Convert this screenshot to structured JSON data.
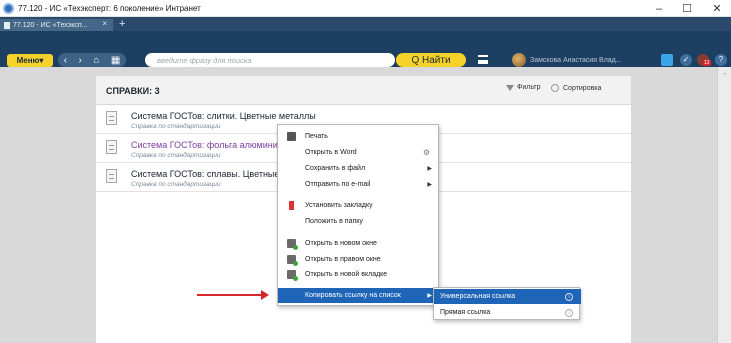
{
  "window": {
    "title": "77.120 - ИС «Техэксперт: 6 поколение» Интранет",
    "minimize": "–",
    "maximize": "☐",
    "close": "✕"
  },
  "tabs": {
    "active_label": "77.120 - ИС «Техэксп...",
    "close": "×",
    "add": "+"
  },
  "toolbar": {
    "menu_label": "Меню▾",
    "search_placeholder": "введите фразу для поиска",
    "find_label": "Q Найти",
    "user_name": "Замскова Анастасия Влад...",
    "notification_count": "12",
    "help": "?"
  },
  "panel": {
    "title": "СПРАВКИ: 3",
    "filter_label": "Фильтр",
    "sort_label": "Сортировка",
    "documents": [
      {
        "title": "Система ГОСТов: слитки. Цветные металлы",
        "subtitle": "Справка по стандартизации"
      },
      {
        "title": "Система ГОСТов: фольга алюминие",
        "subtitle": "Справка по стандартизации"
      },
      {
        "title": "Система ГОСТов: сплавы. Цветные",
        "subtitle": "Справка по стандартизации"
      }
    ]
  },
  "context_menu": {
    "items": [
      {
        "label": "Печать",
        "icon": "printer-icon"
      },
      {
        "label": "Открыть в Word",
        "icon": "gear-icon"
      },
      {
        "label": "Сохранить в файл",
        "icon": "submenu-arrow"
      },
      {
        "label": "Отправить по e-mail",
        "icon": "submenu-arrow"
      },
      {
        "label": "Установить закладку",
        "icon": "bookmark-icon"
      },
      {
        "label": "Положить в папку",
        "icon": ""
      },
      {
        "label": "Открыть в новом окне",
        "icon": "window-icon"
      },
      {
        "label": "Открыть в правом окне",
        "icon": "window-icon"
      },
      {
        "label": "Открыть в новой вкладке",
        "icon": "window-icon"
      },
      {
        "label": "Копировать ссылку на список",
        "icon": "submenu-arrow"
      }
    ]
  },
  "submenu": {
    "items": [
      {
        "label": "Универсальная ссылка"
      },
      {
        "label": "Прямая ссылка"
      }
    ]
  },
  "colors": {
    "accent": "#1e65b8",
    "toolbar": "#1d3f62",
    "button_yellow": "#f5d22a",
    "arrow_red": "#d6272b"
  }
}
